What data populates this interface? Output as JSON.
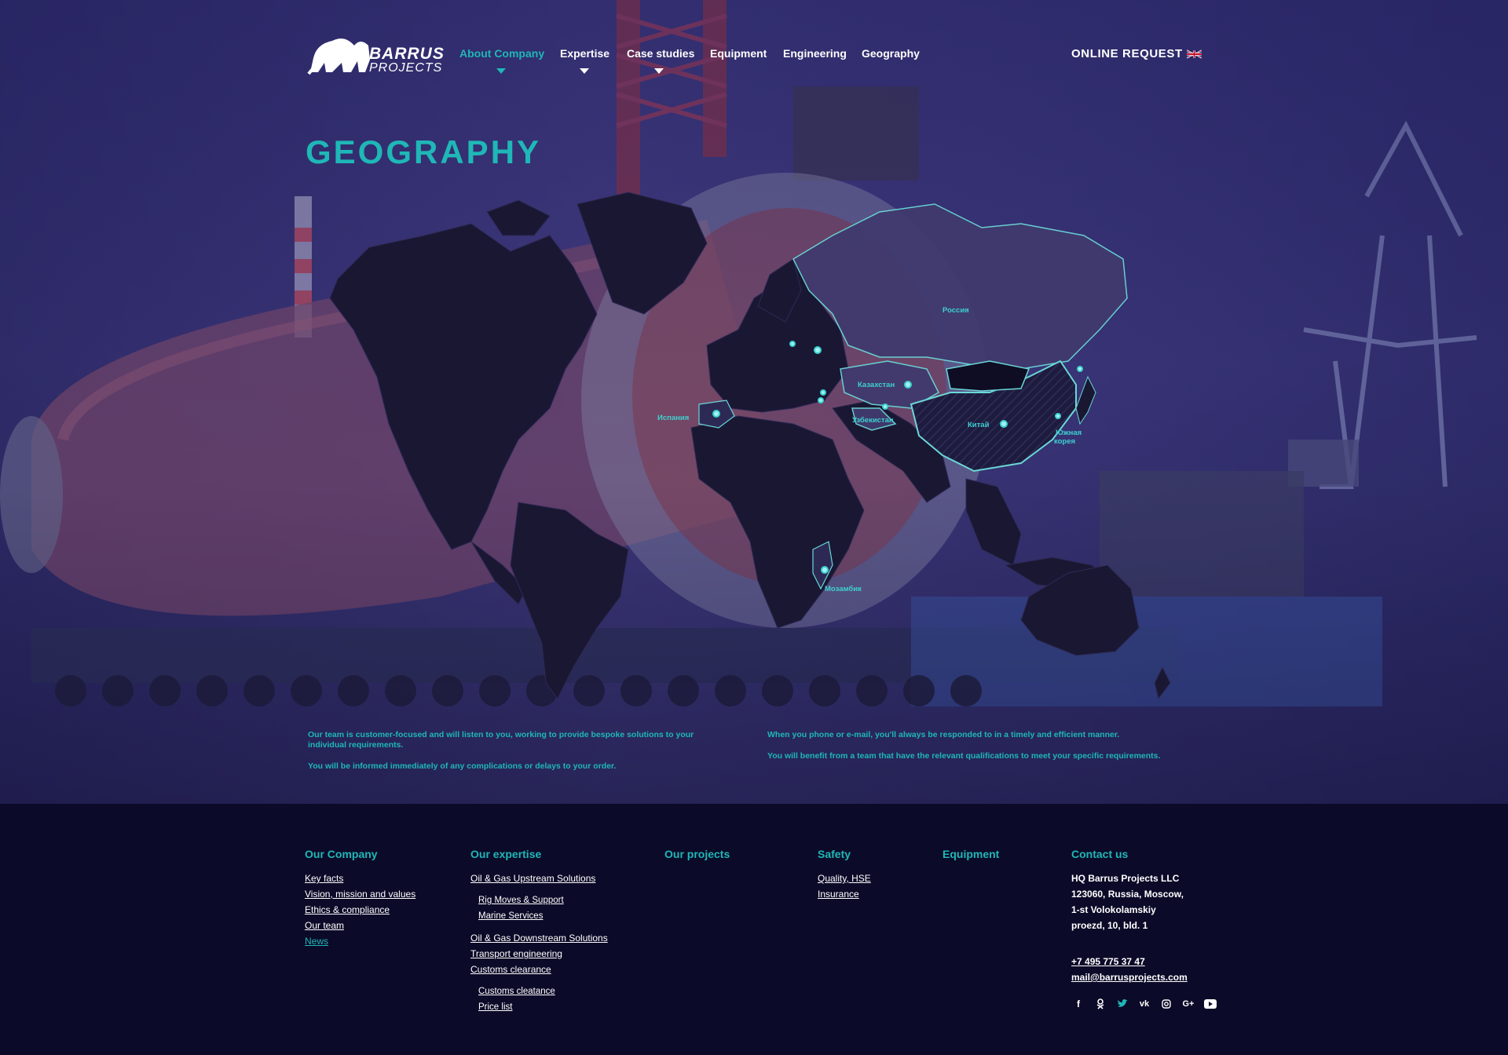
{
  "brand": {
    "name": "BARRUS",
    "sub": "PROJECTS"
  },
  "nav": {
    "items": [
      {
        "label": "About Company",
        "has_submenu": true,
        "active": true
      },
      {
        "label": "Expertise",
        "has_submenu": true
      },
      {
        "label": "Case studies",
        "has_submenu": true
      },
      {
        "label": "Equipment",
        "has_submenu": false
      },
      {
        "label": "Engineering",
        "has_submenu": false
      },
      {
        "label": "Geography",
        "has_submenu": false
      }
    ],
    "online_request": "ONLINE REQUEST",
    "language_flag": "uk-flag-icon"
  },
  "page": {
    "title": "GEOGRAPHY"
  },
  "map": {
    "labels": {
      "russia": "Россия",
      "kazakhstan": "Казахстан",
      "uzbekistan": "Узбекистан",
      "china": "Китай",
      "korea_1": "Южная",
      "korea_2": "корея",
      "spain": "Испания",
      "mozambique": "Мозамбик"
    }
  },
  "info": {
    "left_1": "Our team is customer-focused and will listen to you, working to provide bespoke solutions to your individual requirements.",
    "left_2": "You will be informed immediately of any complications or delays to your order.",
    "right_1": "When you phone or e-mail, you'll always be responded to in a timely and efficient manner.",
    "right_2": "You will benefit from a team that have the relevant qualifications to meet your specific requirements."
  },
  "footer": {
    "company": {
      "heading": "Our Company",
      "links": [
        "Key facts",
        "Vision, mission and values",
        "Ethics & compliance",
        "Our team",
        "News"
      ]
    },
    "expertise": {
      "heading": "Our expertise",
      "upstream": "Oil & Gas Upstream Solutions",
      "upstream_sub": [
        "Rig Moves & Support",
        "Marine Services"
      ],
      "downstream": "Oil & Gas Downstream Solutions",
      "transport": "Transport engineering",
      "customs": "Customs clearance",
      "customs_sub": [
        "Customs cleatance",
        "Price list"
      ]
    },
    "projects": {
      "heading": "Our projects"
    },
    "safety": {
      "heading": "Safety",
      "links": [
        "Quality, HSE",
        "Insurance"
      ]
    },
    "equipment": {
      "heading": "Equipment"
    },
    "contacts": {
      "heading": "Contact us",
      "address": [
        "HQ Barrus Projects LLC",
        "123060, Russia, Moscow,",
        "1-st Volokolamskiy",
        "proezd, 10, bld. 1"
      ],
      "phone": "+7 495 775 37 47",
      "email": "mail@barrusprojects.com",
      "socials": [
        "facebook-icon",
        "odnoklassniki-icon",
        "twitter-icon",
        "vk-icon",
        "instagram-icon",
        "google-plus-icon",
        "youtube-icon"
      ]
    }
  },
  "colors": {
    "accent": "#1fb7b7",
    "footer_bg": "#0b0a28",
    "map_land": "#1a1733"
  }
}
